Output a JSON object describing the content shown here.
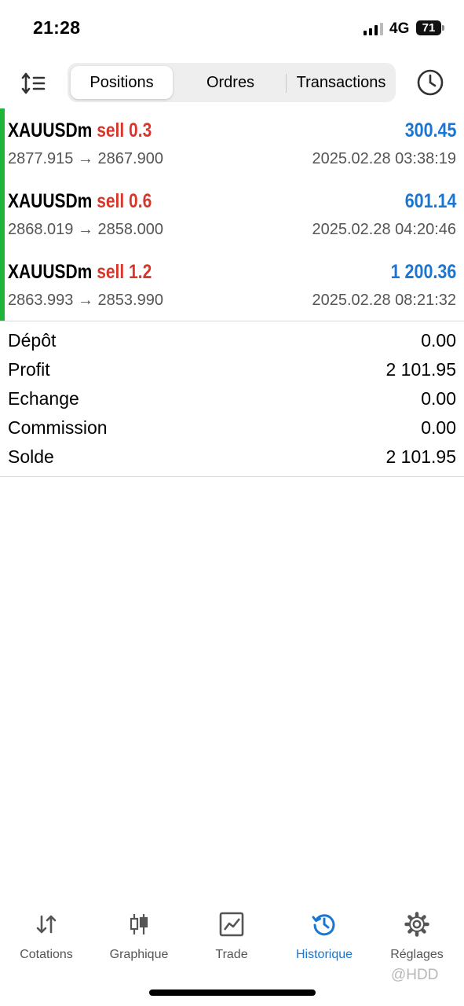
{
  "status_bar": {
    "time": "21:28",
    "network": "4G",
    "battery": "71"
  },
  "segments": [
    {
      "label": "Positions",
      "active": true
    },
    {
      "label": "Ordres",
      "active": false
    },
    {
      "label": "Transactions",
      "active": false
    }
  ],
  "positions": [
    {
      "symbol": "XAUUSDm",
      "side": "sell 0.3",
      "profit": "300.45",
      "prices": "2877.915 → 2867.900",
      "time": "2025.02.28 03:38:19"
    },
    {
      "symbol": "XAUUSDm",
      "side": "sell 0.6",
      "profit": "601.14",
      "prices": "2868.019 → 2858.000",
      "time": "2025.02.28 04:20:46"
    },
    {
      "symbol": "XAUUSDm",
      "side": "sell 1.2",
      "profit": "1 200.36",
      "prices": "2863.993 → 2853.990",
      "time": "2025.02.28 08:21:32"
    }
  ],
  "summary": [
    {
      "label": "Dépôt",
      "value": "0.00"
    },
    {
      "label": "Profit",
      "value": "2 101.95"
    },
    {
      "label": "Echange",
      "value": "0.00"
    },
    {
      "label": "Commission",
      "value": "0.00"
    },
    {
      "label": "Solde",
      "value": "2 101.95"
    }
  ],
  "tabs": [
    {
      "label": "Cotations",
      "icon": "arrows-updown-icon"
    },
    {
      "label": "Graphique",
      "icon": "candlestick-icon"
    },
    {
      "label": "Trade",
      "icon": "trade-chart-icon"
    },
    {
      "label": "Historique",
      "icon": "history-icon",
      "active": true
    },
    {
      "label": "Réglages",
      "icon": "gear-icon"
    }
  ],
  "watermark": "@HDD",
  "colors": {
    "accent": "#1976d2",
    "sell": "#d9362b",
    "marker": "#1fb53a"
  }
}
